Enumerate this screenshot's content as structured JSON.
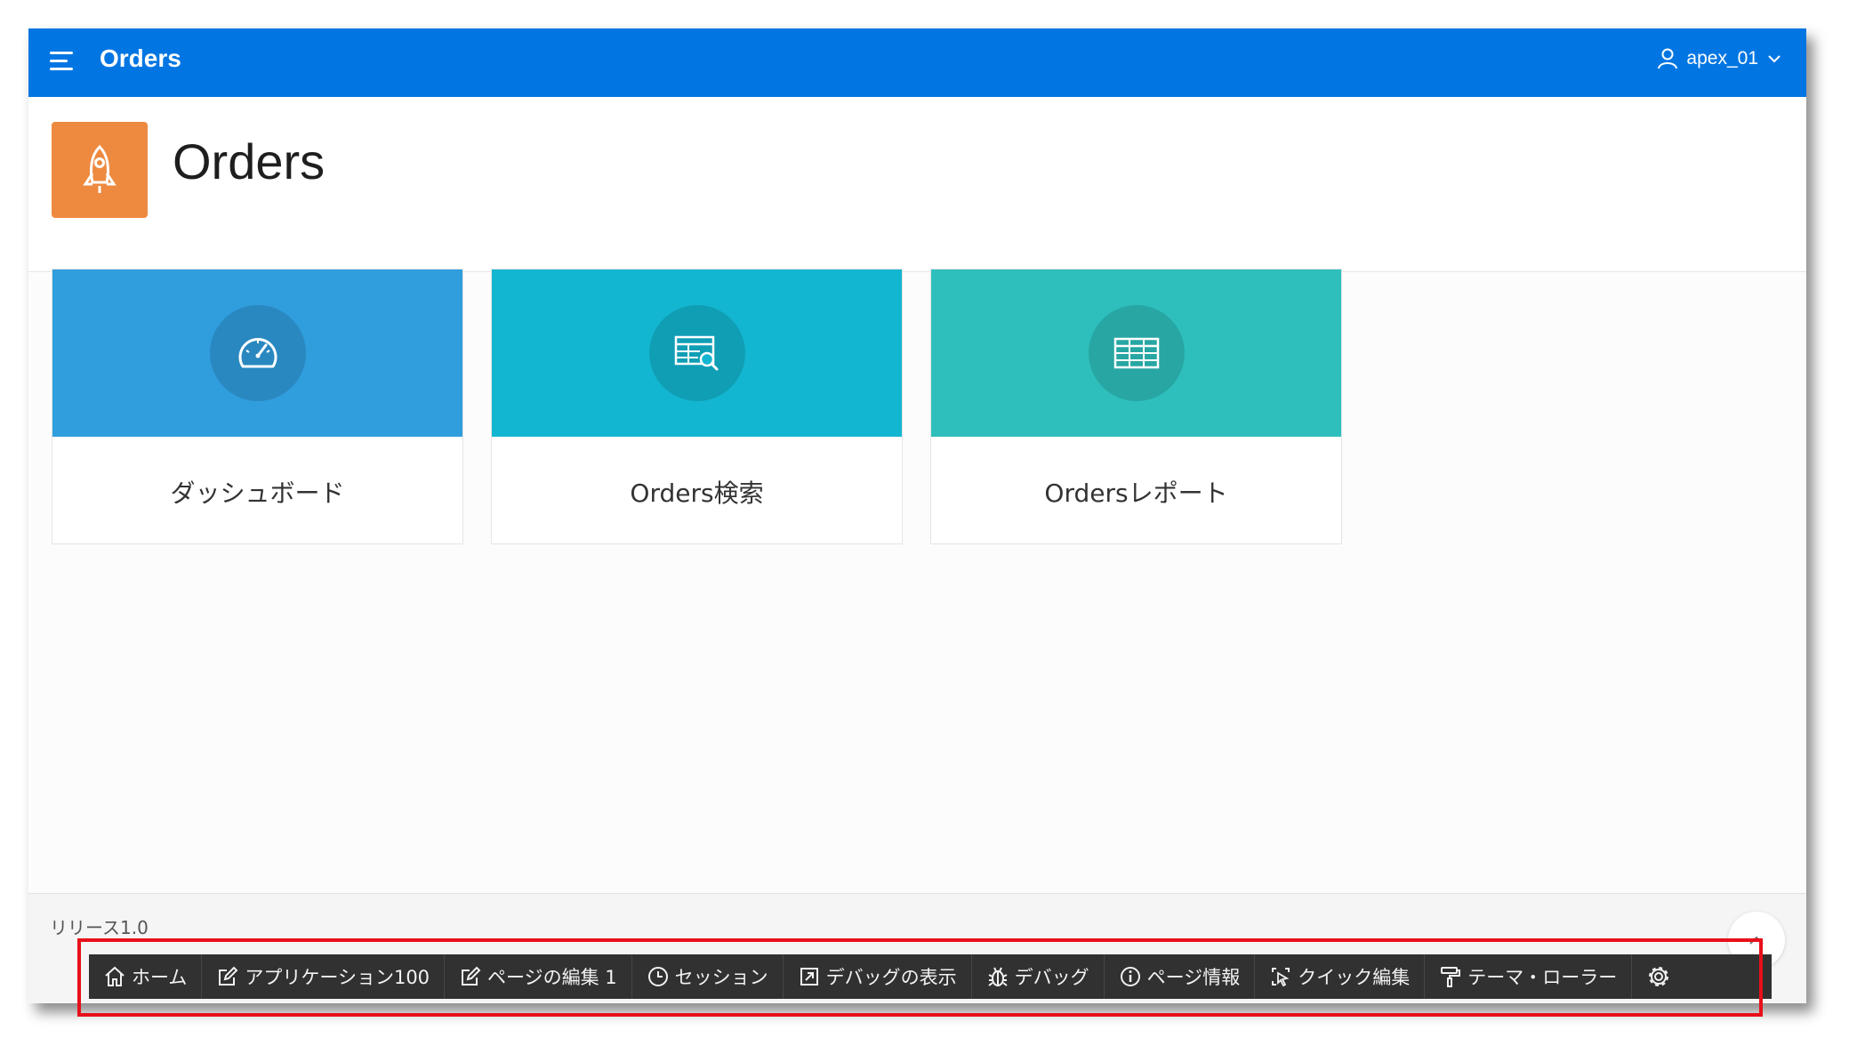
{
  "header": {
    "app_title": "Orders",
    "user_name": "apex_01"
  },
  "hero": {
    "title": "Orders"
  },
  "cards": [
    {
      "label": "ダッシュボード",
      "color": "#309ddd",
      "icon": "dashboard-gauge-icon"
    },
    {
      "label": "Orders検索",
      "color": "#13b6d0",
      "icon": "table-search-icon"
    },
    {
      "label": "Ordersレポート",
      "color": "#2ebfbc",
      "icon": "table-grid-icon"
    }
  ],
  "footer": {
    "release": "リリース1.0"
  },
  "developer_toolbar": {
    "items": [
      {
        "label": "ホーム",
        "icon": "home-icon"
      },
      {
        "label": "アプリケーション100",
        "icon": "edit-icon"
      },
      {
        "label": "ページの編集 1",
        "icon": "edit-icon"
      },
      {
        "label": "セッション",
        "icon": "clock-icon"
      },
      {
        "label": "デバッグの表示",
        "icon": "external-link-icon"
      },
      {
        "label": "デバッグ",
        "icon": "bug-icon"
      },
      {
        "label": "ページ情報",
        "icon": "info-icon"
      },
      {
        "label": "クイック編集",
        "icon": "cursor-select-icon"
      },
      {
        "label": "テーマ・ローラー",
        "icon": "paint-roller-icon"
      },
      {
        "label": "",
        "icon": "gear-icon"
      }
    ]
  },
  "colors": {
    "header": "#0176e2",
    "hero_icon": "#ee8a3f",
    "devbar": "#313131",
    "highlight": "#e8101a"
  }
}
